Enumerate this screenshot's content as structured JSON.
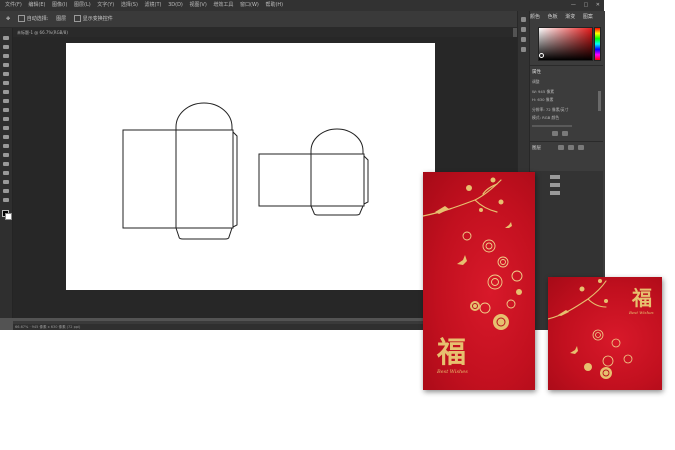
{
  "menu": {
    "items": [
      "文件(F)",
      "编辑(E)",
      "图像(I)",
      "图层(L)",
      "文字(Y)",
      "选择(S)",
      "滤镜(T)",
      "3D(D)",
      "视图(V)",
      "增效工具",
      "窗口(W)",
      "帮助(H)"
    ],
    "window_controls": [
      "—",
      "□",
      "✕"
    ]
  },
  "options_bar": {
    "items": [
      "自动选择:",
      "图层",
      "显示变换控件"
    ]
  },
  "document": {
    "tab": "未标题-1 @ 66.7%(RGB/8)",
    "status": "66.67%  ·  945 像素 x 630 像素 (72 ppi)"
  },
  "panels": {
    "color_tabs": [
      "颜色",
      "色板",
      "渐变",
      "图案"
    ],
    "properties_title": "属性",
    "adjustments_label": "调整",
    "row_width": "W: 945 像素",
    "row_height": "H: 630 像素",
    "row_resolution": "分辨率: 72 像素/英寸",
    "row_mode": "模式: RGB 颜色",
    "layers_title": "图层",
    "colors": {
      "picked": "#e41a1a"
    }
  },
  "mockup": {
    "large_char": "福",
    "large_caption": "Best Wishes",
    "small_char": "福",
    "small_caption": "Best Wishes",
    "colors": {
      "envelope_red": "#c2101f",
      "gold": "#e7c06f"
    }
  }
}
